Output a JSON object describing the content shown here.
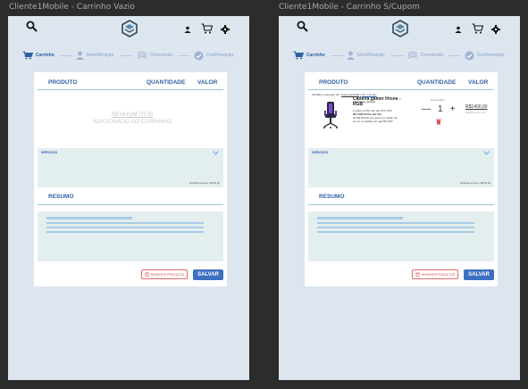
{
  "frames": [
    {
      "title": "Cliente1Mobile -  Carrinho Vazio",
      "steps": [
        "Carrinho",
        "Identificação",
        "Conclusão",
        "Confirmação"
      ],
      "table": {
        "col_produto": "PRODUTO",
        "col_quantidade": "QUANTIDADE",
        "col_valor": "VALOR"
      },
      "empty_line1": "NENHUM ITEM",
      "empty_line2": "ADICIONADO AO CARRINHO",
      "services_label": "SERVIÇOS",
      "services_footer": "Subtotal serviços: R$ 00,00",
      "summary_title": "RESUMO",
      "remove_label": "REMOVER PRODUTOS",
      "save_label": "SALVAR"
    },
    {
      "title": "Cliente1Mobile -  Carrinho S/Cupom",
      "steps": [
        "Carrinho",
        "Identificação",
        "Conclusão",
        "Confirmação"
      ],
      "table": {
        "col_produto": "PRODUTO",
        "col_quantidade": "QUANTIDADE",
        "col_valor": "VALOR"
      },
      "seller_text": "Vendido e entregue por:",
      "seller_name": "Loja Queimada",
      "seller_link": "Ver entregas",
      "product": {
        "brand": "Fabricante: Bregail",
        "name": "Cadeira gamer Hrone - RGB",
        "desc1": "A vista no PIX com até 10% OFF",
        "desc2": "R$ 1400,00 Em até 10x",
        "desc3": "de R$ 140,00 sem juros no cartão Ou",
        "desc4": "em 1x no cartão com até 5% OFF",
        "qty_label": "Quantidade",
        "qty_minus": "—",
        "qty": "1",
        "qty_plus": "+",
        "price": "R$1400,00",
        "price_sub": "R$1400,00 à vist"
      },
      "services_label": "SERVIÇOS",
      "services_footer": "Subtotal serviços: R$ 00,00",
      "summary_title": "RESUMO",
      "remove_label": "REMOVER PRODUTOS",
      "save_label": "SALVAR"
    }
  ],
  "icons": [
    "search-icon",
    "brand-logo-icon",
    "user-icon",
    "cart-icon",
    "gear-icon",
    "chevron-down-icon",
    "trash-icon",
    "check-badge-icon",
    "truck-icon",
    "wallet-icon"
  ],
  "colors": {
    "accent": "#2f5fa7",
    "step_muted": "#9fb2d6",
    "save_button": "#3d6fc2",
    "remove_red": "#d74b4b",
    "panel": "#e3eeef",
    "frame_bg": "#dde5ee"
  }
}
